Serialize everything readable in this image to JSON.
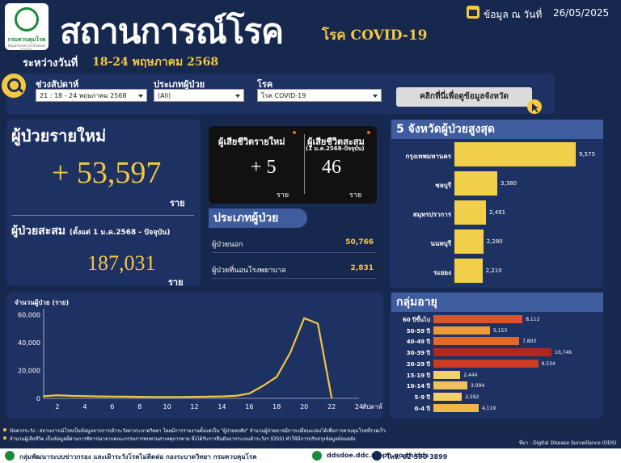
{
  "header": {
    "logo_caption": "กรมควบคุมโรค",
    "logo_sub": "Department of Disease Control",
    "title": "สถานการณ์โรค",
    "title_sub": "โรค COVID-19",
    "data_as_of_label": "ข้อมูล ณ วันที่",
    "data_as_of_value": "26/05/2025",
    "range_label": "ระหว่างวันที่",
    "range_value": "18-24 พฤษภาคม 2568"
  },
  "filters": {
    "week_label": "ช่วงสัปดาห์",
    "week_value": "21 : 18 - 24 พฤษภาคม 2568",
    "patient_type_label": "ประเภทผู้ป่วย",
    "patient_type_value": "(All)",
    "disease_label": "โรค",
    "disease_value": "โรค COVID-19",
    "province_button": "คลิกที่นี่เพื่อดูข้อมูลจังหวัด"
  },
  "new_cases": {
    "label": "ผู้ป่วยรายใหม่",
    "value": "+ 53,597",
    "unit": "ราย"
  },
  "cumulative": {
    "label": "ผู้ป่วยสะสม",
    "label_note": "(ตั้งแต่ 1 ม.ค.2568 - ปัจจุบัน)",
    "value": "187,031",
    "unit": "ราย"
  },
  "deaths": {
    "new_label": "ผู้เสียชีวิตรายใหม่",
    "new_value": "+ 5",
    "new_unit": "ราย",
    "cum_label": "ผู้เสียชีวิตสะสม",
    "cum_note": "(1 ม.ค.2568-ปัจจุบัน)",
    "cum_value": "46",
    "cum_unit": "ราย"
  },
  "patient_types": {
    "title": "ประเภทผู้ป่วย",
    "rows": [
      {
        "label": "ผู้ป่วยนอก",
        "value": "50,766"
      },
      {
        "label": "ผู้ป่วยที่นอนโรงพยาบาล",
        "value": "2,831"
      }
    ]
  },
  "top_provinces": {
    "title": "5 จังหวัดผู้ป่วยสูงสุด",
    "items": [
      {
        "name": "กรุงเทพมหานคร",
        "value": 9575,
        "label": "9,575"
      },
      {
        "name": "ชลบุรี",
        "value": 3380,
        "label": "3,380"
      },
      {
        "name": "สมุทรปราการ",
        "value": 2491,
        "label": "2,491"
      },
      {
        "name": "นนทบุรี",
        "value": 2280,
        "label": "2,280"
      },
      {
        "name": "ระยอง",
        "value": 2210,
        "label": "2,210"
      }
    ]
  },
  "age_groups": {
    "title": "กลุ่มอายุ",
    "items": [
      {
        "name": "60 ปีขึ้นไป",
        "value": 8112,
        "label": "8,112",
        "color": "#d9542a"
      },
      {
        "name": "50-59 ปี",
        "value": 5153,
        "label": "5,153",
        "color": "#ee9a3a"
      },
      {
        "name": "40-49 ปี",
        "value": 7803,
        "label": "7,803",
        "color": "#e06a2c"
      },
      {
        "name": "30-39 ปี",
        "value": 10746,
        "label": "10,746",
        "color": "#b3261e"
      },
      {
        "name": "20-29 ปี",
        "value": 9534,
        "label": "9,534",
        "color": "#cc3a22"
      },
      {
        "name": "15-19 ปี",
        "value": 2444,
        "label": "2,444",
        "color": "#f2cf6a"
      },
      {
        "name": "10-14 ปี",
        "value": 3094,
        "label": "3,094",
        "color": "#f2c25a"
      },
      {
        "name": "5-9 ปี",
        "value": 2592,
        "label": "2,592",
        "color": "#f2cf6a"
      },
      {
        "name": "0-4 ปี",
        "value": 4119,
        "label": "4,119",
        "color": "#f0b84a"
      }
    ]
  },
  "chart_data": {
    "type": "line",
    "title": "จำนวนผู้ป่วย (ราย)",
    "xlabel": "สัปดาห์",
    "ylabel": "จำนวนผู้ป่วย (ราย)",
    "x": [
      1,
      2,
      3,
      4,
      5,
      6,
      7,
      8,
      9,
      10,
      11,
      12,
      13,
      14,
      15,
      16,
      17,
      18,
      19,
      20,
      21,
      22
    ],
    "series": [
      {
        "values": [
          1500,
          2200,
          1800,
          1600,
          1400,
          1300,
          1200,
          1100,
          1000,
          1000,
          1000,
          1100,
          1200,
          1400,
          1800,
          3500,
          9000,
          15500,
          33000,
          57500,
          53600,
          400
        ]
      }
    ],
    "xticks": [
      2,
      4,
      6,
      8,
      10,
      12,
      14,
      16,
      18,
      20,
      22,
      24
    ],
    "yticks": [
      0,
      20000,
      40000,
      60000
    ],
    "ytick_labels": [
      "0",
      "20,000",
      "40,000",
      "60,000"
    ],
    "xlim": [
      1,
      24
    ],
    "ylim": [
      0,
      62000
    ],
    "grid": false
  },
  "notes": {
    "note1": "ข้อควรระวัง : สถานการณ์โรคเป็นข้อมูลจากการเฝ้าระวังทางระบาดวิทยา โดยมีการรายงานตั้งแต่เป็น \"ผู้ป่วยสงสัย\" จำนวนผู้ป่วยอาจมีการเปลี่ยนแปลงได้เพื่อการควบคุมโรคที่รวดเร็ว",
    "note2": "จำนวนผู้เสียชีวิต เป็นข้อมูลที่ผ่านการพิจารณาจากคณะกรรมการทบทวนสาเหตุการตาย ซึ่งได้รับการยืนยันจากระบบเฝ้าระวังฯ (DSS) ทำให้มีการปรับปรุงข้อมูลย้อนหลัง",
    "source": "ที่มา : Digital Disease Surveillance (DDS)"
  },
  "footer": {
    "org": "กลุ่มพัฒนาระบบข่าวกรอง และเฝ้าระวังโรคไม่ติดต่อ กองระบาดวิทยา กรมควบคุมโรค",
    "website": "ddsdoe.ddc.moph.go.th/dds",
    "phone": "โทร. 02 590 3899"
  }
}
